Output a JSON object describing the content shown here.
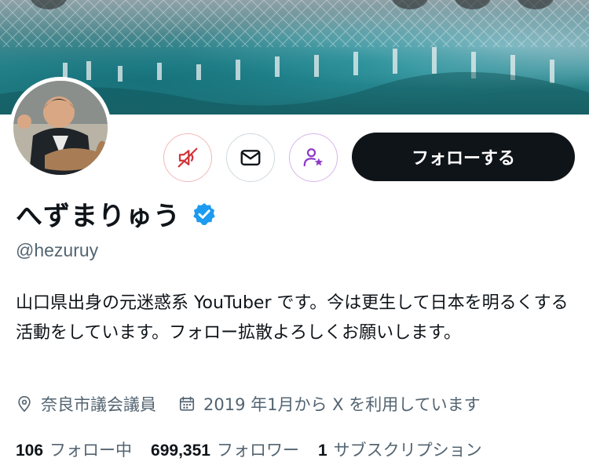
{
  "profile": {
    "display_name": "へずまりゅう",
    "handle": "@hezuruy",
    "bio": "山口県出身の元迷惑系 YouTuber です。今は更生して日本を明るくする活動をしています。フォロー拡散よろしくお願いします。",
    "location": "奈良市議会議員",
    "joined": "2019 年1月から X を利用しています",
    "verified": true
  },
  "actions": {
    "mute_icon": "speaker-muted-icon",
    "message_icon": "envelope-icon",
    "subscribe_icon": "person-star-icon",
    "follow_label": "フォローする"
  },
  "stats": {
    "following_count": "106",
    "following_label": "フォロー中",
    "followers_count": "699,351",
    "followers_label": "フォロワー",
    "subscriptions_count": "1",
    "subscriptions_label": "サブスクリプション"
  },
  "colors": {
    "text_primary": "#0f1419",
    "text_secondary": "#536471",
    "verified_blue": "#1d9bf0",
    "mute_red": "#d0353a",
    "subscribe_purple": "#8e3bc8",
    "follow_button_bg": "#0f1419"
  }
}
